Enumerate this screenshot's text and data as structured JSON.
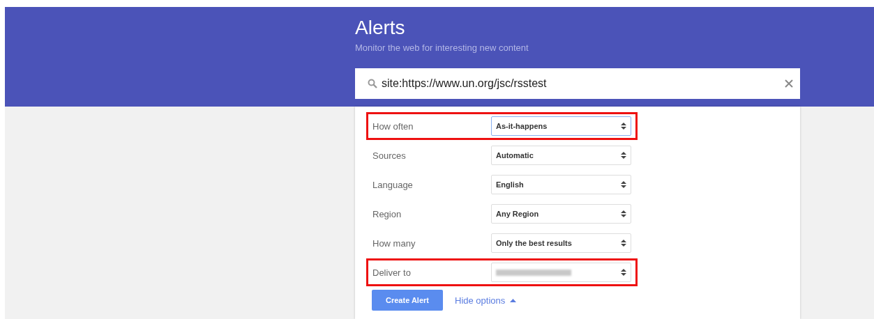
{
  "header": {
    "title": "Alerts",
    "subtitle": "Monitor the web for interesting new content"
  },
  "search": {
    "value": "site:https://www.un.org/jsc/rsstest"
  },
  "options": [
    {
      "label": "How often",
      "value": "As-it-happens",
      "highlighted": true,
      "focused": true,
      "kind": "text"
    },
    {
      "label": "Sources",
      "value": "Automatic",
      "highlighted": false,
      "focused": false,
      "kind": "text"
    },
    {
      "label": "Language",
      "value": "English",
      "highlighted": false,
      "focused": false,
      "kind": "text"
    },
    {
      "label": "Region",
      "value": "Any Region",
      "highlighted": false,
      "focused": false,
      "kind": "text"
    },
    {
      "label": "How many",
      "value": "Only the best results",
      "highlighted": false,
      "focused": false,
      "kind": "text"
    },
    {
      "label": "Deliver to",
      "highlighted": true,
      "focused": false,
      "kind": "redacted"
    }
  ],
  "create_button": "Create Alert",
  "options_link": "Hide options"
}
